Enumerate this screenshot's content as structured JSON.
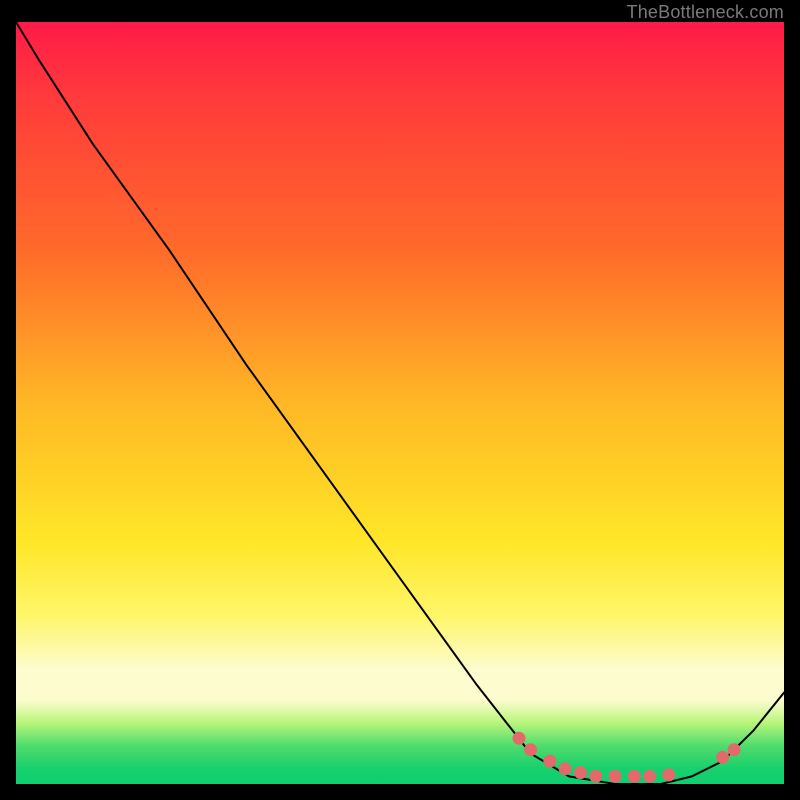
{
  "attribution": "TheBottleneck.com",
  "chart_data": {
    "type": "line",
    "series": [
      {
        "name": "curve",
        "x": [
          0.0,
          0.03,
          0.1,
          0.2,
          0.3,
          0.4,
          0.5,
          0.6,
          0.67,
          0.72,
          0.78,
          0.84,
          0.88,
          0.92,
          0.96,
          1.0
        ],
        "y": [
          1.0,
          0.95,
          0.84,
          0.7,
          0.55,
          0.41,
          0.27,
          0.13,
          0.04,
          0.01,
          0.0,
          0.0,
          0.01,
          0.03,
          0.07,
          0.12
        ]
      },
      {
        "name": "markers",
        "x": [
          0.655,
          0.67,
          0.695,
          0.715,
          0.735,
          0.755,
          0.78,
          0.805,
          0.825,
          0.85,
          0.92,
          0.935
        ],
        "y": [
          0.06,
          0.045,
          0.03,
          0.02,
          0.015,
          0.01,
          0.01,
          0.01,
          0.01,
          0.012,
          0.035,
          0.045
        ]
      }
    ],
    "xlim": [
      0,
      1
    ],
    "ylim": [
      0,
      1
    ],
    "marker_color": "#e36a6a",
    "line_color": "#000000",
    "background_gradient": [
      "#ff1a47",
      "#ffe627",
      "#0ecf71"
    ]
  }
}
